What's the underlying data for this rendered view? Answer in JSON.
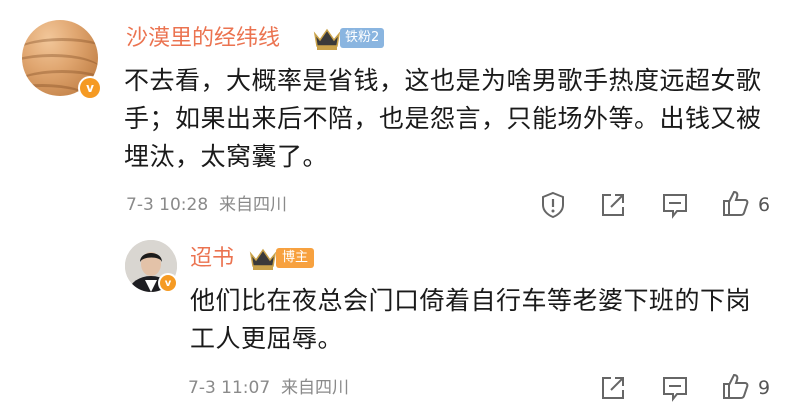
{
  "comment": {
    "username": "沙漠里的经纬线",
    "fan_badge": "铁粉2",
    "verified_mark": "v",
    "text": "不去看，大概率是省钱，这也是为啥男歌手热度远超女歌手；如果出来后不陪，也是怨言，只能场外等。出钱又被埋汰，太窝囊了。",
    "time": "7-3 10:28",
    "location": "来自四川",
    "like_count": "6"
  },
  "reply": {
    "username": "迢书",
    "host_badge": "博主",
    "verified_mark": "v",
    "text": "他们比在夜总会门口倚着自行车等老婆下班的下岗工人更屈辱。",
    "time": "7-3 11:07",
    "location": "来自四川",
    "like_count": "9"
  },
  "colors": {
    "username": "#eb7350",
    "meta_gray": "#8a8a8a",
    "fan_badge_bg": "#8ab5e0",
    "host_badge_bg": "#f7a13f",
    "verified_orange": "#f59a23",
    "crown_gold": "#c9a24a"
  },
  "icons": {
    "report": "shield-exclamation-icon",
    "share": "share-arrow-icon",
    "reply": "comment-bubble-icon",
    "like": "thumbs-up-icon",
    "crown": "crown-icon"
  }
}
